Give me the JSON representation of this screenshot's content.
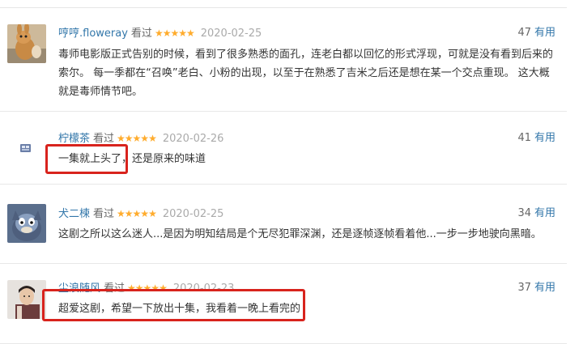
{
  "reviews": [
    {
      "user": "哼哼.floweray",
      "status": "看过",
      "stars": "★★★★★",
      "date": "2020-02-25",
      "votes": "47",
      "useful_label": "有用",
      "content": "毒师电影版正式告别的时候，看到了很多熟悉的面孔，连老白都以回忆的形式浮现，可就是没有看到后来的索尔。 每一季都在“召唤”老白、小粉的出现，以至于在熟悉了吉米之后还是想在某一个交点重现。 这大概就是毒师情节吧。"
    },
    {
      "user": "柠檬茶",
      "status": "看过",
      "stars": "★★★★★",
      "date": "2020-02-26",
      "votes": "41",
      "useful_label": "有用",
      "content": "一集就上头了，还是原来的味道"
    },
    {
      "user": "犬二楝",
      "status": "看过",
      "stars": "★★★★★",
      "date": "2020-02-25",
      "votes": "34",
      "useful_label": "有用",
      "content": "这剧之所以这么迷人...是因为明知结局是个无尽犯罪深渊，还是逐帧逐帧看着他...一步一步地驶向黑暗。"
    },
    {
      "user": "尘浪随风",
      "status": "看过",
      "stars": "★★★★★",
      "date": "2020-02-23",
      "votes": "37",
      "useful_label": "有用",
      "content": "超爱这剧，希望一下放出十集，我看着一晚上看完的"
    }
  ],
  "colors": {
    "link": "#3377aa",
    "star": "#ffac2d",
    "highlight": "#d8231d"
  }
}
